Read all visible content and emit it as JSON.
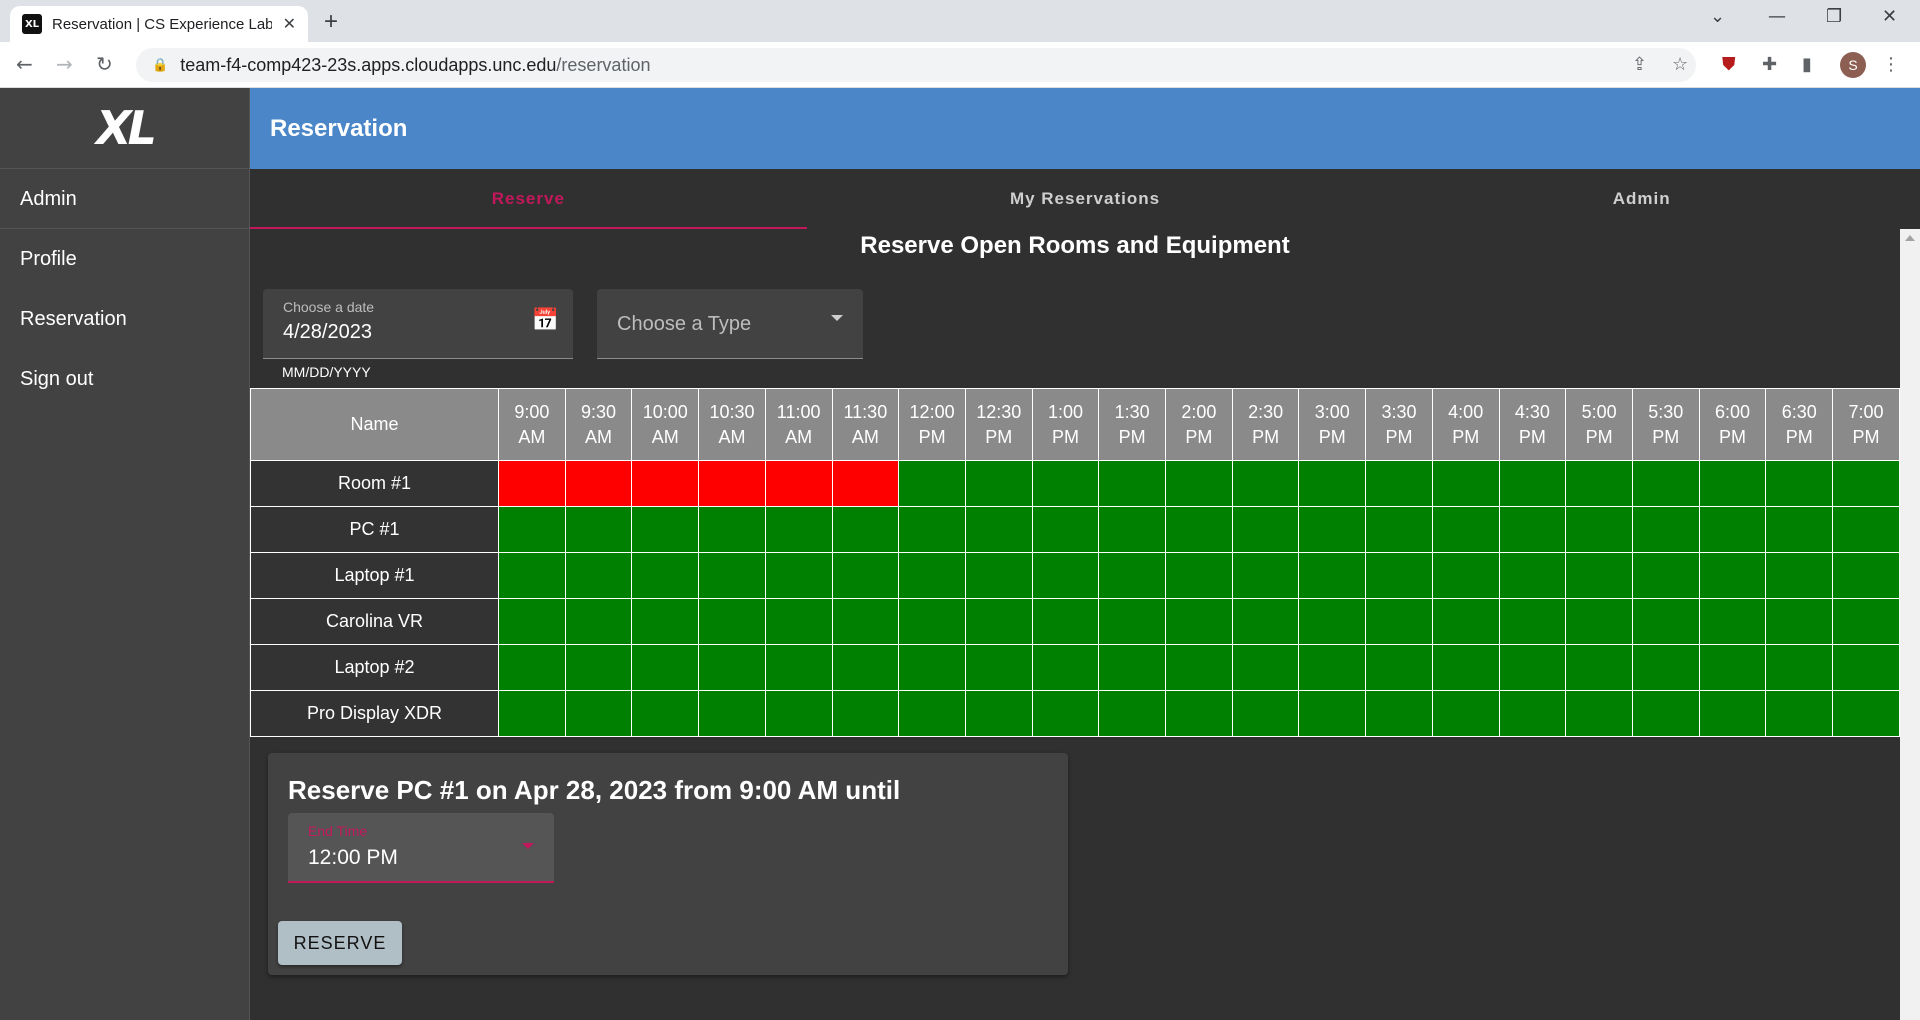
{
  "browser": {
    "tab_title": "Reservation | CS Experience Labs",
    "tab_favicon": "XL",
    "url_host": "team-f4-comp423-23s.apps.cloudapps.unc.edu",
    "url_path": "/reservation",
    "profile_initial": "S"
  },
  "app": {
    "logo": "XL",
    "sidenav": [
      "Admin",
      "Profile",
      "Reservation",
      "Sign out"
    ],
    "appbar_title": "Reservation",
    "tabs": [
      "Reserve",
      "My Reservations",
      "Admin"
    ],
    "active_tab": 0,
    "page_title": "Reserve Open Rooms and Equipment",
    "date_field": {
      "label": "Choose a date",
      "value": "4/28/2023",
      "hint": "MM/DD/YYYY"
    },
    "type_field": {
      "placeholder": "Choose a Type"
    },
    "schedule": {
      "name_header": "Name",
      "times": [
        [
          "9:00",
          "AM"
        ],
        [
          "9:30",
          "AM"
        ],
        [
          "10:00",
          "AM"
        ],
        [
          "10:30",
          "AM"
        ],
        [
          "11:00",
          "AM"
        ],
        [
          "11:30",
          "AM"
        ],
        [
          "12:00",
          "PM"
        ],
        [
          "12:30",
          "PM"
        ],
        [
          "1:00",
          "PM"
        ],
        [
          "1:30",
          "PM"
        ],
        [
          "2:00",
          "PM"
        ],
        [
          "2:30",
          "PM"
        ],
        [
          "3:00",
          "PM"
        ],
        [
          "3:30",
          "PM"
        ],
        [
          "4:00",
          "PM"
        ],
        [
          "4:30",
          "PM"
        ],
        [
          "5:00",
          "PM"
        ],
        [
          "5:30",
          "PM"
        ],
        [
          "6:00",
          "PM"
        ],
        [
          "6:30",
          "PM"
        ],
        [
          "7:00",
          "PM"
        ]
      ],
      "rows": [
        {
          "name": "Room #1",
          "reserved_slots": [
            0,
            1,
            2,
            3,
            4,
            5
          ]
        },
        {
          "name": "PC #1",
          "reserved_slots": []
        },
        {
          "name": "Laptop #1",
          "reserved_slots": []
        },
        {
          "name": "Carolina VR",
          "reserved_slots": []
        },
        {
          "name": "Laptop #2",
          "reserved_slots": []
        },
        {
          "name": "Pro Display XDR",
          "reserved_slots": []
        }
      ],
      "colors": {
        "available": "#008000",
        "reserved": "#ff0000"
      }
    },
    "reserve_card": {
      "title": "Reserve PC #1 on Apr 28, 2023 from 9:00 AM until",
      "end_time_label": "End Time",
      "end_time_value": "12:00 PM",
      "button": "RESERVE"
    }
  }
}
